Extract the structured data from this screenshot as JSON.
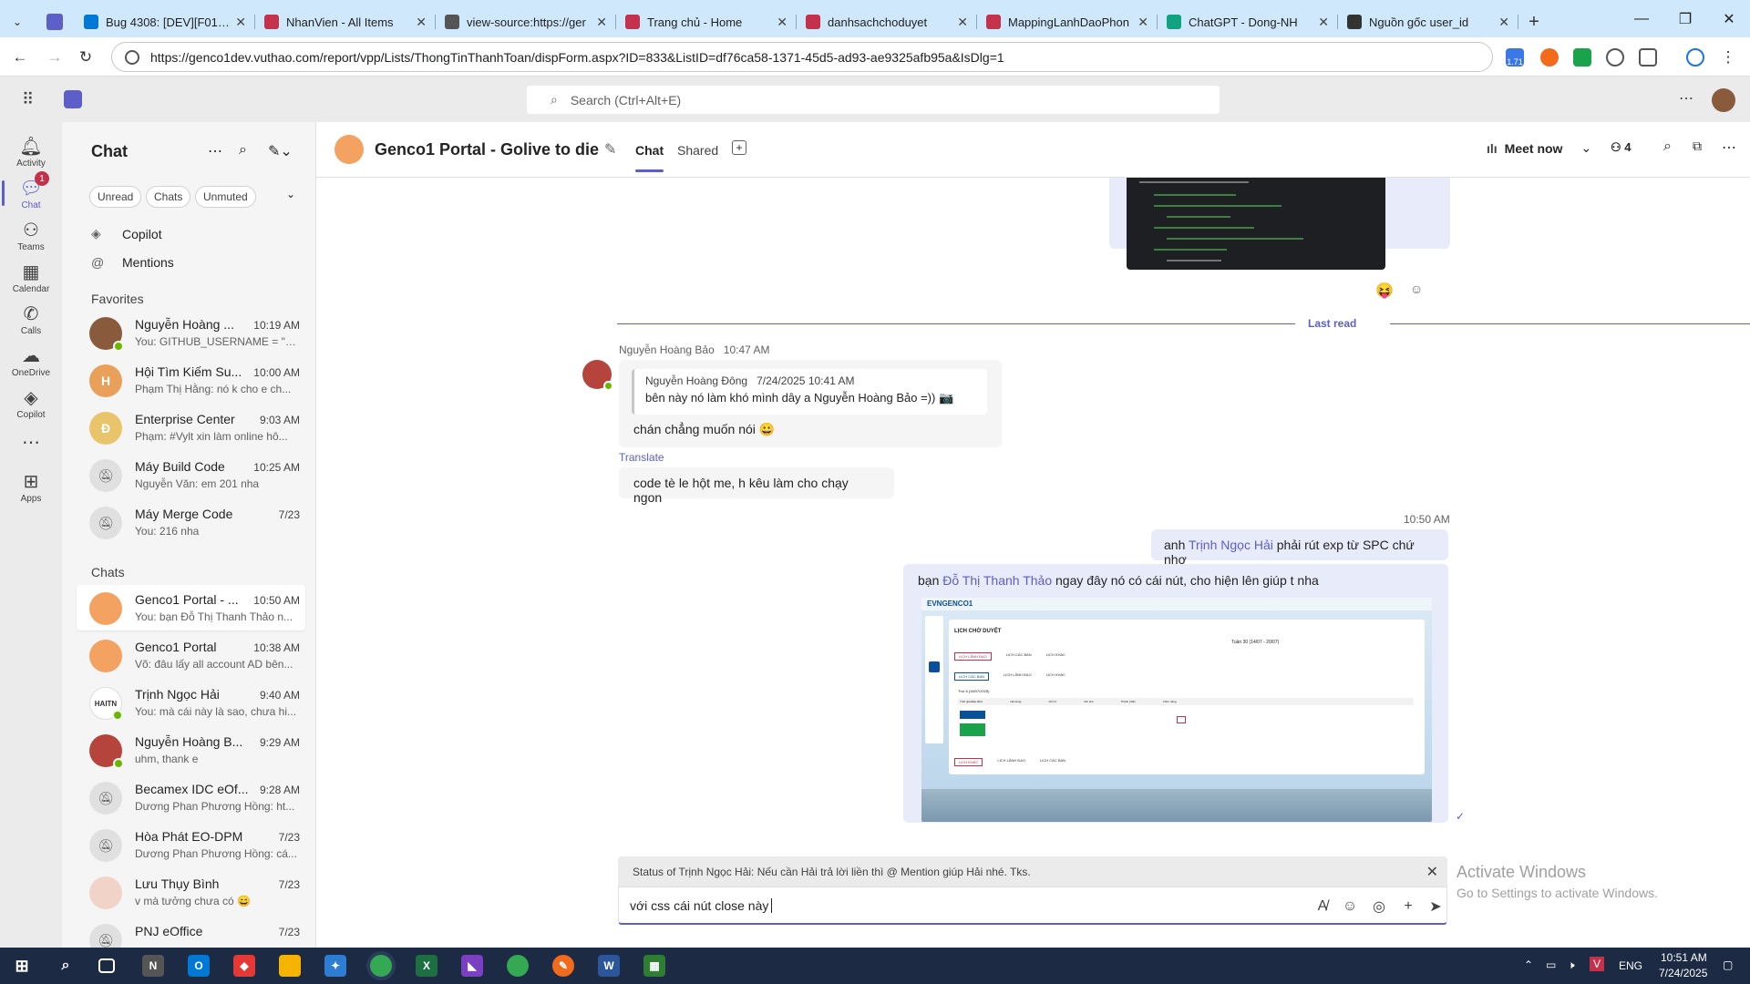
{
  "browser": {
    "tabs": [
      {
        "label": "Bug 4308: [DEV][F01.03",
        "color": "#0078d4"
      },
      {
        "label": "NhanVien - All Items",
        "color": "#c4314b"
      },
      {
        "label": "view-source:https://ger",
        "color": "#555555"
      },
      {
        "label": "Trang chủ - Home",
        "color": "#c4314b"
      },
      {
        "label": "danhsachchoduyet",
        "color": "#c4314b"
      },
      {
        "label": "MappingLanhDaoPhon",
        "color": "#c4314b"
      },
      {
        "label": "ChatGPT - Dong-NH",
        "color": "#10a37f"
      },
      {
        "label": "Nguồn gốc user_id",
        "color": "#333333"
      }
    ],
    "url": "https://genco1dev.vuthao.com/report/vpp/Lists/ThongTinThanhToan/dispForm.aspx?ID=833&ListID=df76ca58-1371-45d5-ad93-ae9325afb95a&IsDlg=1",
    "ext_badge": "1.71"
  },
  "teams": {
    "search_placeholder": "Search (Ctrl+Alt+E)",
    "rail": [
      {
        "label": "Activity",
        "icon": "bell-icon"
      },
      {
        "label": "Chat",
        "icon": "chat-icon",
        "badge": "1"
      },
      {
        "label": "Teams",
        "icon": "teams-icon"
      },
      {
        "label": "Calendar",
        "icon": "calendar-icon"
      },
      {
        "label": "Calls",
        "icon": "phone-icon"
      },
      {
        "label": "OneDrive",
        "icon": "cloud-icon"
      },
      {
        "label": "Copilot",
        "icon": "copilot-icon"
      },
      {
        "label": "...",
        "icon": "more-icon"
      },
      {
        "label": "Apps",
        "icon": "apps-icon"
      }
    ],
    "chatlist": {
      "title": "Chat",
      "filters": [
        "Unread",
        "Chats",
        "Unmuted"
      ],
      "pinned": [
        "Copilot",
        "Mentions"
      ],
      "favorites_label": "Favorites",
      "chats_label": "Chats",
      "favorites": [
        {
          "name": "Nguyễn Hoàng ...",
          "time": "10:19 AM",
          "preview": "You: GITHUB_USERNAME = \"n...",
          "initial": "",
          "color": "#8a5a3c",
          "online": true
        },
        {
          "name": "Hội Tìm Kiếm Su...",
          "time": "10:00 AM",
          "preview": "Phạm Thị Hằng: nó k cho e ch...",
          "initial": "H",
          "color": "#e8a05a",
          "online": false
        },
        {
          "name": "Enterprise Center",
          "time": "9:03 AM",
          "preview": "Phạm: #Vylt xin làm online hô...",
          "initial": "Đ",
          "color": "#e9c46a",
          "online": false
        },
        {
          "name": "Máy Build Code",
          "time": "10:25 AM",
          "preview": "Nguyễn Văn: em 201 nha",
          "initial": "",
          "color": "#e0e0e0",
          "online": false
        },
        {
          "name": "Máy Merge Code",
          "time": "7/23",
          "preview": "You: 216  nha",
          "initial": "",
          "color": "#e0e0e0",
          "online": false
        }
      ],
      "chats": [
        {
          "name": "Genco1 Portal - ...",
          "time": "10:50 AM",
          "preview": "You: bạn Đỗ Thị Thanh Thảo n...",
          "initial": "",
          "color": "#f4a261",
          "online": false,
          "bold": true
        },
        {
          "name": "Genco1 Portal",
          "time": "10:38 AM",
          "preview": "Võ: đâu lấy all account AD bên...",
          "initial": "",
          "color": "#f4a261",
          "online": false
        },
        {
          "name": "Trịnh Ngọc Hải",
          "time": "9:40 AM",
          "preview": "You: mà cái này là sao, chưa hi...",
          "initial": "HAITN",
          "color": "#ffffff",
          "online": true
        },
        {
          "name": "Nguyễn Hoàng B...",
          "time": "9:29 AM",
          "preview": "uhm, thank e",
          "initial": "",
          "color": "#b5443c",
          "online": true
        },
        {
          "name": "Becamex IDC eOf...",
          "time": "9:28 AM",
          "preview": "Dương Phan Phương Hồng: ht...",
          "initial": "",
          "color": "#e0e0e0",
          "online": false
        },
        {
          "name": "Hòa Phát EO-DPM",
          "time": "7/23",
          "preview": "Dương Phan Phương Hồng: cá...",
          "initial": "",
          "color": "#e0e0e0",
          "online": false
        },
        {
          "name": "Lưu Thụy Bình",
          "time": "7/23",
          "preview": "v mà tưởng chưa có 😄",
          "initial": "",
          "color": "#f1d3c8",
          "online": false
        },
        {
          "name": "PNJ eOffice",
          "time": "7/23",
          "preview": "",
          "initial": "",
          "color": "#e0e0e0",
          "online": false
        }
      ]
    },
    "conversation": {
      "title": "Genco1 Portal - Golive to die",
      "tabs": [
        "Chat",
        "Shared"
      ],
      "meet_now": "Meet now",
      "participants": "4",
      "last_read": "Last read",
      "msg1": {
        "sender": "Nguyễn Hoàng Bảo",
        "time": "10:47 AM",
        "quote_sender": "Nguyễn Hoàng Đông",
        "quote_time": "7/24/2025 10:41 AM",
        "quote_text": "bên này nó làm khó mình dây a Nguyễn Hoàng Bảo =)) 📷",
        "text": "chán chẳng muốn nói 😀",
        "translate": "Translate",
        "text2": "code tè le hột me, h kêu làm cho chạy ngon"
      },
      "msg2": {
        "time": "10:50 AM",
        "text_pre": "anh ",
        "mention": "Trịnh Ngọc Hải",
        "text_post": " phải rút exp từ SPC chứ nhợ"
      },
      "msg3": {
        "text_pre": "bạn ",
        "mention": "Đỗ Thị Thanh Thảo",
        "text_post": " ngay đây nó có cái nút, cho hiện lên giúp t nha",
        "shot": {
          "brand": "EVNGENCO1",
          "heading": "LỊCH CHỜ DUYỆT",
          "week": "Tuần 30 (14/07 - 20/07)",
          "tabs1": [
            "LỊCH LÃNH ĐẠO",
            "LỊCH CÁC BAN",
            "LỊCH KHÁC"
          ],
          "tabs2": [
            "LỊCH CÁC BAN",
            "LỊCH LÃNH ĐẠO",
            "LỊCH KHÁC"
          ],
          "tabs3": [
            "LỊCH KHÁC",
            "LỊCH LÃNH ĐẠO",
            "LỊCH CÁC BAN"
          ],
          "day": "Thứ 6 (18/07/2025)",
          "cols": [
            "Thời gian/Địa điểm",
            "Nội dung",
            "Chủ trì",
            "Ghi chú",
            "Thành phần",
            "Chức năng"
          ]
        }
      },
      "status_bar": "Status of Trịnh Ngọc Hải: Nếu cần Hải trả lời liền thì @ Mention giúp Hải nhé. Tks.",
      "composer_text": "với css cái nút close này",
      "watermark_title": "Activate Windows",
      "watermark_sub": "Go to Settings to activate Windows."
    }
  },
  "taskbar": {
    "lang": "ENG",
    "time": "10:51 AM",
    "date": "7/24/2025"
  }
}
